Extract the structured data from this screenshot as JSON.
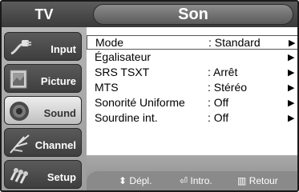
{
  "sidebar": {
    "title": "TV",
    "items": [
      {
        "label": "Input",
        "icon": "input-plug-icon",
        "active": false
      },
      {
        "label": "Picture",
        "icon": "picture-icon",
        "active": false
      },
      {
        "label": "Sound",
        "icon": "speaker-icon",
        "active": true
      },
      {
        "label": "Channel",
        "icon": "antenna-icon",
        "active": false
      },
      {
        "label": "Setup",
        "icon": "gears-icon",
        "active": false
      }
    ]
  },
  "header": {
    "title": "Son"
  },
  "menu": {
    "rows": [
      {
        "label": "Mode",
        "value": ": Standard",
        "selected": true
      },
      {
        "label": "Égalisateur",
        "value": ""
      },
      {
        "label": "SRS TSXT",
        "value": ":  Arrêt"
      },
      {
        "label": "MTS",
        "value": ": Stéréo"
      },
      {
        "label": "Sonorité Uniforme",
        "value": ": Off"
      },
      {
        "label": "Sourdine int.",
        "value": ": Off"
      }
    ]
  },
  "footer": {
    "move": "Dépl.",
    "enter": "Intro.",
    "return": "Retour"
  }
}
